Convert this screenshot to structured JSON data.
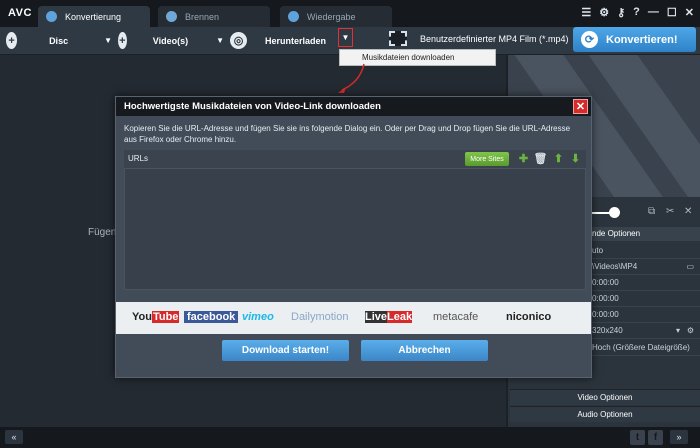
{
  "app": {
    "logo": "AVC"
  },
  "tabs": [
    {
      "label": "Konvertierung",
      "active": true
    },
    {
      "label": "Brennen",
      "active": false
    },
    {
      "label": "Wiedergabe",
      "active": false
    }
  ],
  "toolbar": {
    "disc_label": "Disc",
    "videos_label": "Video(s)",
    "download_label": "Herunterladen",
    "profile_label": "Benutzerdefinierter MP4 Film (*.mp4)",
    "convert_label": "Konvertieren!"
  },
  "tooltip": {
    "text": "Musikdateien downloaden"
  },
  "main": {
    "hint_text": "Fügen"
  },
  "right_panel": {
    "settings_header": "nde Optionen",
    "rows": [
      "uto",
      "\\Videos\\MP4",
      "0:00:00",
      "0:00:00",
      "0:00:00",
      "320x240",
      "Hoch (Größere Dateigröße)"
    ],
    "video_options": "Video Optionen",
    "audio_options": "Audio Optionen"
  },
  "dialog": {
    "title": "Hochwertigste Musikdateien von Video-Link downloaden",
    "instructions": "Kopieren Sie die URL-Adresse und fügen Sie sie ins folgende Dialog ein. Oder per Drag und Drop fügen Sie die URL-Adresse aus Firefox oder Chrome hinzu.",
    "urls_label": "URLs",
    "more_sites_label": "More Sites",
    "sites": [
      "YouTube",
      "facebook",
      "vimeo",
      "Dailymotion",
      "LiveLeak",
      "metacafe",
      "niconico"
    ],
    "start_label": "Download starten!",
    "cancel_label": "Abbrechen"
  },
  "colors": {
    "accent": "#3b86c8",
    "close": "#d72a2a",
    "green": "#6db33f"
  }
}
